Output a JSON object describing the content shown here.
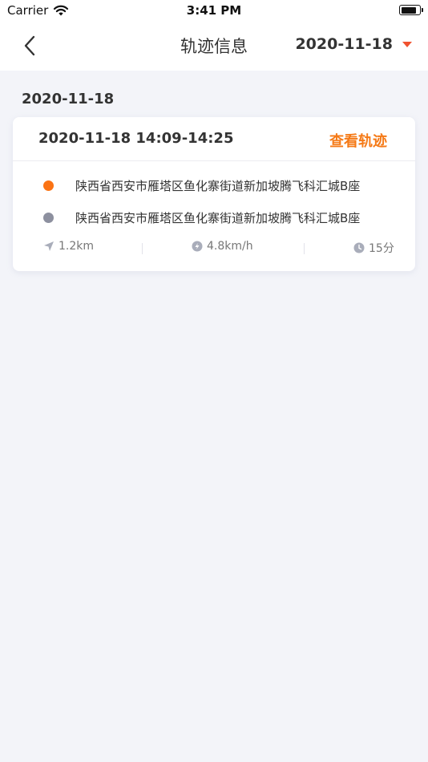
{
  "status_bar": {
    "carrier": "Carrier",
    "time": "3:41 PM",
    "battery_level": 0.85
  },
  "nav": {
    "title": "轨迹信息",
    "selected_date": "2020-11-18",
    "accent_color": "#f0522f"
  },
  "section": {
    "date": "2020-11-18"
  },
  "trip": {
    "time_range": "2020-11-18 14:09-14:25",
    "view_track_label": "查看轨迹",
    "start_location": "陕西省西安市雁塔区鱼化寨街道新加坡腾飞科汇城B座",
    "end_location": "陕西省西安市雁塔区鱼化寨街道新加坡腾飞科汇城B座",
    "start_dot_color": "#fb7314",
    "end_dot_color": "#8d909f",
    "stats": {
      "distance": "1.2km",
      "speed": "4.8km/h",
      "duration": "15分"
    }
  }
}
